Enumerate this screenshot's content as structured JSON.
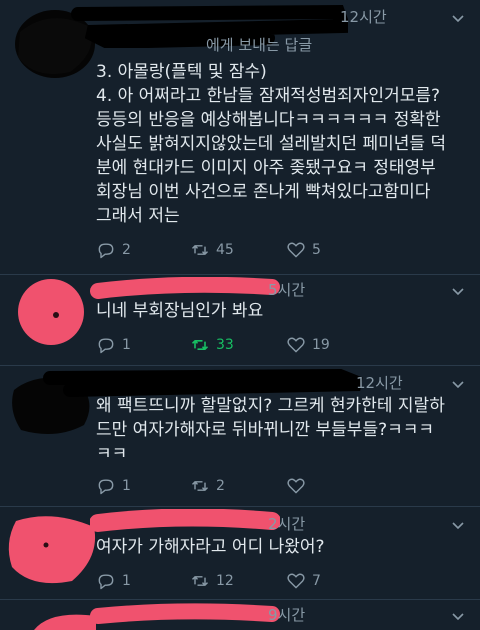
{
  "tweets": [
    {
      "time": "12시간",
      "reply_to": "에게 보내는 답글",
      "lines": [
        "3. 아몰랑(플텍 및 잠수)",
        "4. 아 어쩌라고 한남들 잠재적성범죄자인거모름?",
        "등등의 반응을 예상해봅니다ㅋㅋㅋㅋㅋㅋ 정확한",
        "사실도 밝혀지지않았는데 설레발치던 페미년들 덕",
        "분에 현대카드 이미지 아주 좆됐구요ㅋ 정태영부",
        "회장님 이번 사건으로 존나게 빡쳐있다고함미다",
        "그래서 저는"
      ],
      "replies": "2",
      "retweets": "45",
      "likes": "5"
    },
    {
      "time": "5시간",
      "lines": [
        "니네 부회장님인가 봐요"
      ],
      "replies": "1",
      "retweets": "33",
      "likes": "19"
    },
    {
      "time": "12시간",
      "lines": [
        "왜 팩트뜨니까 할말없지? 그르케 현카한테 지랄하",
        "드만 여자가해자로 뒤바뀌니깐 부들부들?ㅋㅋㅋ",
        "ㅋㅋ"
      ],
      "replies": "1",
      "retweets": "2",
      "likes": ""
    },
    {
      "time": "2시간",
      "lines": [
        "여자가 가해자라고 어디 나왔어?"
      ],
      "replies": "1",
      "retweets": "12",
      "likes": "7"
    },
    {
      "time": "9시간"
    }
  ],
  "colors": {
    "background": "#15202b",
    "text": "#e1e8ed",
    "muted": "#8899a6",
    "retweet_active": "#17bf63",
    "redaction_pink": "#f0526e",
    "redaction_black": "#000000"
  },
  "icons": [
    "reply-icon",
    "retweet-icon",
    "like-icon",
    "chevron-down-icon"
  ]
}
